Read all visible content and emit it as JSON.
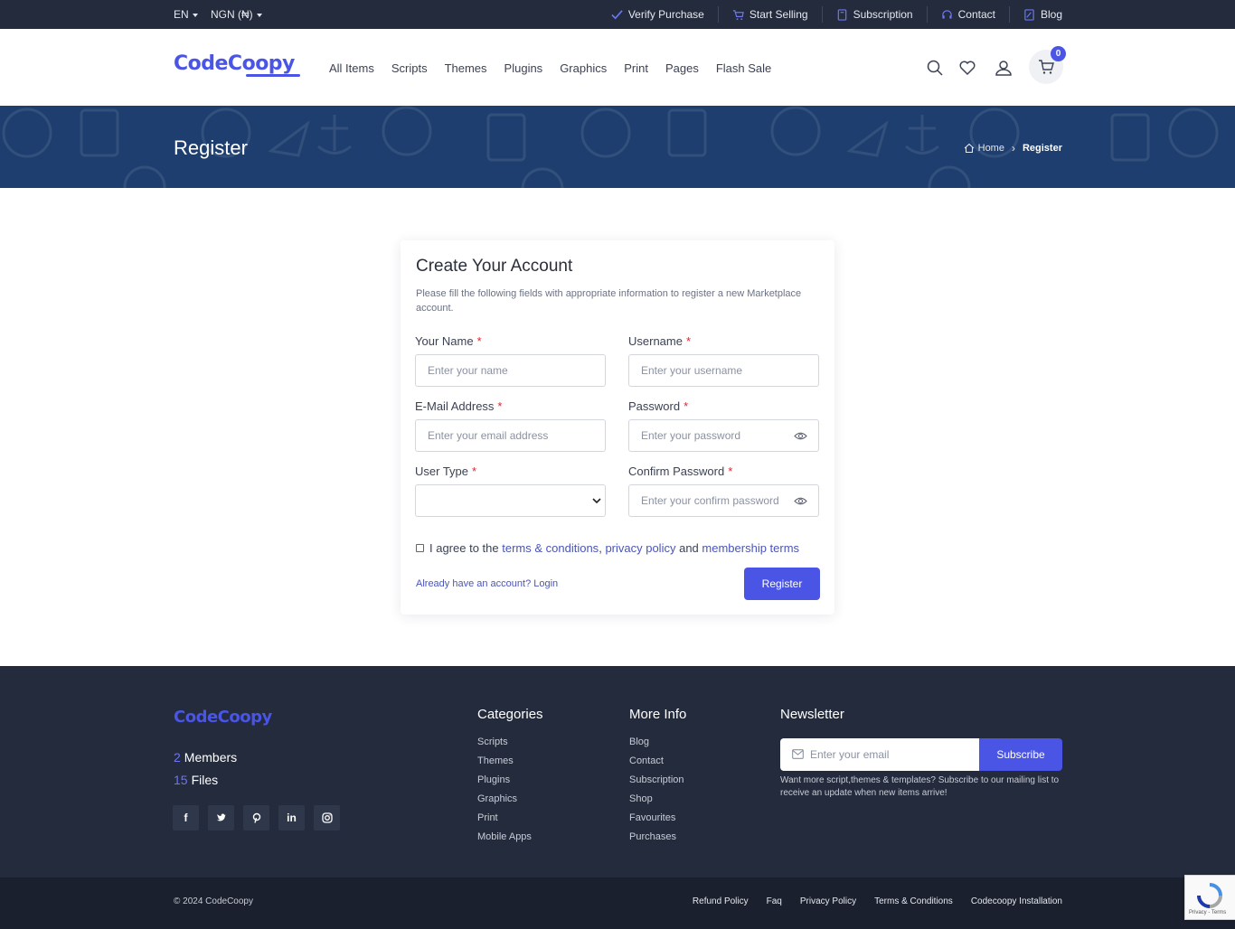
{
  "topbar": {
    "language": "EN",
    "currency": "NGN (₦)",
    "links": [
      {
        "label": "Verify Purchase",
        "icon": "check-icon"
      },
      {
        "label": "Start Selling",
        "icon": "cart-icon"
      },
      {
        "label": "Subscription",
        "icon": "book-icon"
      },
      {
        "label": "Contact",
        "icon": "headset-icon"
      },
      {
        "label": "Blog",
        "icon": "blog-icon"
      }
    ]
  },
  "header": {
    "logo": "CodeCoopy",
    "nav": [
      "All Items",
      "Scripts",
      "Themes",
      "Plugins",
      "Graphics",
      "Print",
      "Pages",
      "Flash Sale"
    ],
    "cart_count": "0"
  },
  "banner": {
    "title": "Register",
    "breadcrumb_home": "Home",
    "breadcrumb_current": "Register"
  },
  "form": {
    "title": "Create Your Account",
    "intro": "Please fill the following fields with appropriate information to register a new Marketplace account.",
    "name_label": "Your Name",
    "name_placeholder": "Enter your name",
    "username_label": "Username",
    "username_placeholder": "Enter your username",
    "email_label": "E-Mail Address",
    "email_placeholder": "Enter your email address",
    "password_label": "Password",
    "password_placeholder": "Enter your password",
    "user_type_label": "User Type",
    "user_type_value": "",
    "confirm_label": "Confirm Password",
    "confirm_placeholder": "Enter your confirm password",
    "required_mark": "*",
    "agree_prefix": "I agree to the",
    "terms_link": "terms & conditions",
    "comma": ",",
    "privacy_link": "privacy policy",
    "and_text": "and",
    "membership_link": "membership terms",
    "login_link": "Already have an account? Login",
    "submit_label": "Register"
  },
  "footer": {
    "logo": "CodeCoopy",
    "members_count": "2",
    "members_label": "Members",
    "files_count": "15",
    "files_label": "Files",
    "social": [
      "facebook-icon",
      "twitter-icon",
      "pinterest-icon",
      "linkedin-icon",
      "instagram-icon"
    ],
    "categories_title": "Categories",
    "categories": [
      "Scripts",
      "Themes",
      "Plugins",
      "Graphics",
      "Print",
      "Mobile Apps"
    ],
    "more_title": "More Info",
    "more": [
      "Blog",
      "Contact",
      "Subscription",
      "Shop",
      "Favourites",
      "Purchases"
    ],
    "newsletter_title": "Newsletter",
    "newsletter_placeholder": "Enter your email",
    "subscribe_label": "Subscribe",
    "newsletter_text": "Want more script,themes & templates? Subscribe to our mailing list to receive an update when new items arrive!"
  },
  "bottombar": {
    "copyright": "© 2024 CodeCoopy",
    "links": [
      "Refund Policy",
      "Faq",
      "Privacy Policy",
      "Terms & Conditions",
      "Codecoopy Installation"
    ]
  },
  "recaptcha": {
    "text": "Privacy - Terms"
  },
  "colors": {
    "accent": "#4a55e6",
    "topbar": "#232b3d",
    "banner": "#1d3e6e",
    "footer": "#232b3d",
    "required": "#e0242f"
  }
}
